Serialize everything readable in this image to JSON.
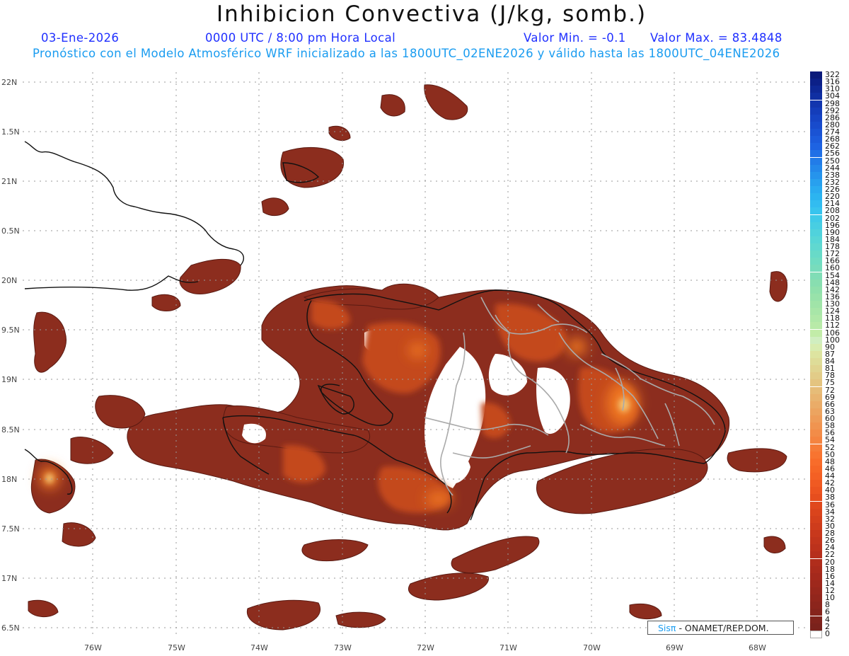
{
  "header": {
    "title": "Inhibicion Convectiva (J/kg, somb.)",
    "date": "03-Ene-2026",
    "time": "0000 UTC / 8:00 pm Hora Local",
    "min_label": "Valor Min. = -0.1",
    "max_label": "Valor Max. = 83.4848",
    "subtitle": "Pronóstico con el Modelo Atmosférico WRF inicializado a las 1800UTC_02ENE2026 y válido hasta las  1800UTC_04ENE2026"
  },
  "map": {
    "lat_labels": [
      "22N",
      "1.5N",
      "21N",
      "0.5N",
      "20N",
      "9.5N",
      "19N",
      "8.5N",
      "18N",
      "7.5N",
      "17N",
      "6.5N"
    ],
    "lon_labels": [
      "76W",
      "75W",
      "74W",
      "73W",
      "72W",
      "71W",
      "70W",
      "69W",
      "68W"
    ],
    "value_range": {
      "min": -0.1,
      "max": 83.4848,
      "units": "J/kg"
    },
    "colors": {
      "low": "#8c2d1e",
      "mid": "#c4481c",
      "high": "#f07820",
      "peak": "#f0c070"
    }
  },
  "colorbar": {
    "levels": [
      "322",
      "316",
      "310",
      "304",
      "298",
      "292",
      "286",
      "280",
      "274",
      "268",
      "262",
      "256",
      "250",
      "244",
      "238",
      "232",
      "226",
      "220",
      "214",
      "208",
      "202",
      "196",
      "190",
      "184",
      "178",
      "172",
      "166",
      "160",
      "154",
      "148",
      "142",
      "136",
      "130",
      "124",
      "118",
      "112",
      "106",
      "100",
      "90",
      "87",
      "84",
      "81",
      "78",
      "75",
      "72",
      "69",
      "66",
      "63",
      "60",
      "58",
      "56",
      "54",
      "52",
      "50",
      "48",
      "46",
      "44",
      "42",
      "40",
      "38",
      "36",
      "34",
      "32",
      "30",
      "28",
      "26",
      "24",
      "22",
      "20",
      "18",
      "16",
      "14",
      "12",
      "10",
      "8",
      "6",
      "4",
      "2",
      "0"
    ],
    "colors": [
      "#0a1a7a",
      "#0c2088",
      "#0e2896",
      "#102fa2",
      "#1236ae",
      "#143dba",
      "#1644c4",
      "#184bcc",
      "#1a53d4",
      "#1c5bdc",
      "#1e63e2",
      "#2070e6",
      "#227ce8",
      "#2488ea",
      "#2694ec",
      "#28a0ee",
      "#2aabf0",
      "#2cb4f0",
      "#32bcf0",
      "#38c4ee",
      "#40cae8",
      "#48cee2",
      "#50d2dc",
      "#58d6d6",
      "#60d8d0",
      "#68dac8",
      "#70dcc2",
      "#78dcbc",
      "#80ddb6",
      "#88deb0",
      "#90e0ac",
      "#98e2aa",
      "#a0e4a8",
      "#a8e6a8",
      "#b0e8a8",
      "#b8eaa8",
      "#c2eca8",
      "#d0eec0",
      "#d8ecb0",
      "#dde4a0",
      "#dedc98",
      "#e0d490",
      "#e2cc88",
      "#e4c480",
      "#e6bc78",
      "#e8b470",
      "#eaac68",
      "#eca460",
      "#ee9c58",
      "#f09450",
      "#f28c48",
      "#f48440",
      "#f67c38",
      "#f87430",
      "#f86c2a",
      "#f66626",
      "#f46024",
      "#f05a22",
      "#ec5420",
      "#e64e1e",
      "#e0481c",
      "#da441c",
      "#d4401c",
      "#ce3c1c",
      "#c8381c",
      "#c2351c",
      "#bc321c",
      "#b62f1c",
      "#b02d1c",
      "#aa2b1c",
      "#a4291c",
      "#9e281c",
      "#98271c",
      "#92261c",
      "#8c251c",
      "#86241c",
      "#80231c",
      "#7a221c",
      "#ffffff"
    ]
  },
  "credit": {
    "sis": "Sisπ",
    "org": "- ONAMET/REP.DOM."
  }
}
